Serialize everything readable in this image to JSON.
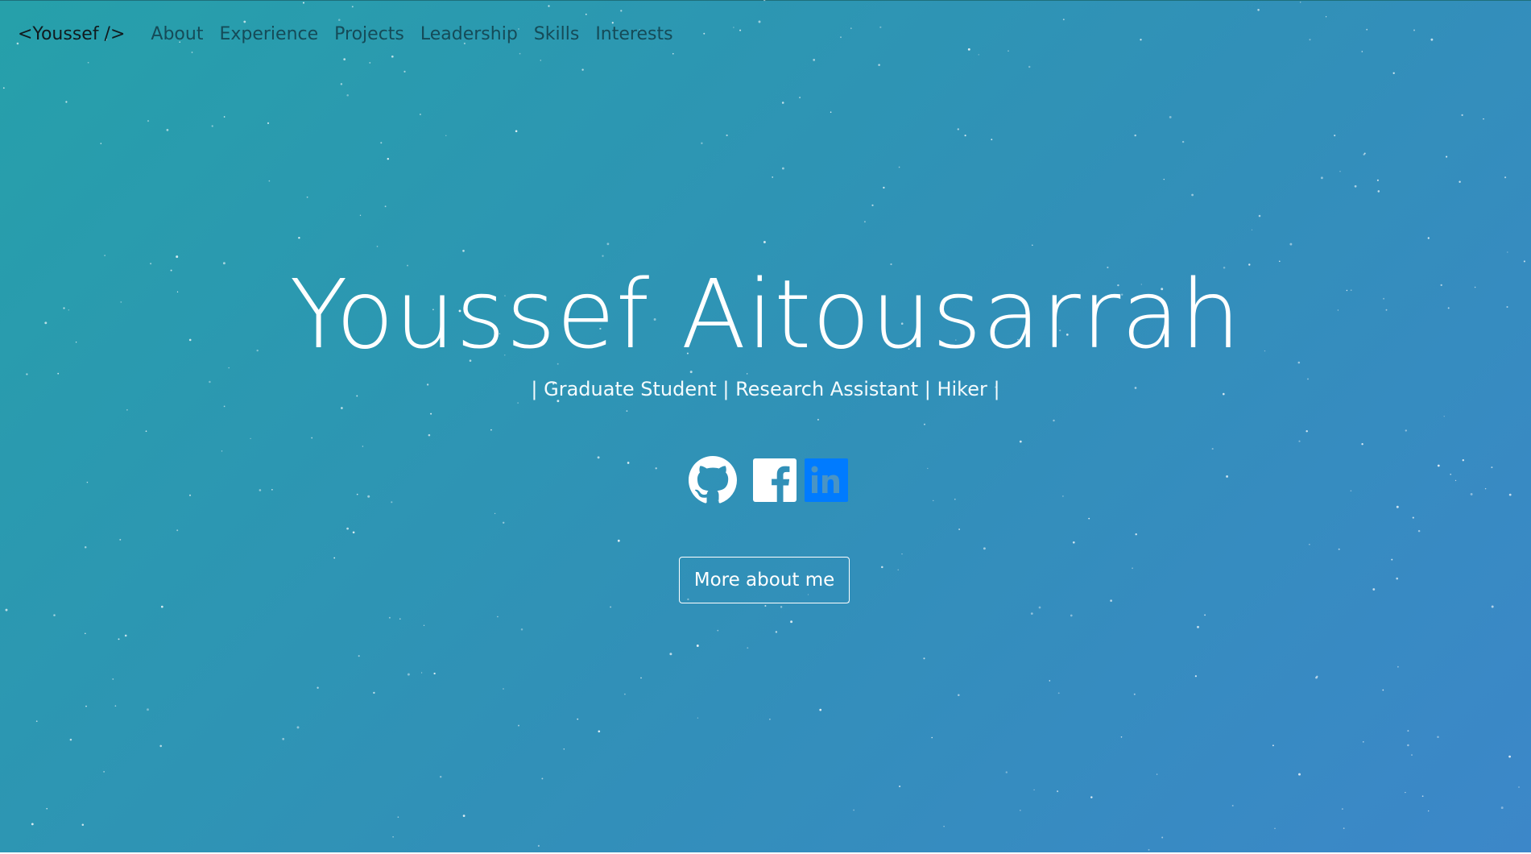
{
  "nav": {
    "brand": "<Youssef />",
    "links": [
      "About",
      "Experience",
      "Projects",
      "Leadership",
      "Skills",
      "Interests"
    ]
  },
  "hero": {
    "name": "Youssef Aitousarrah",
    "tagline": "| Graduate Student | Research Assistant | Hiker |",
    "more_button": "More about me"
  },
  "socials": [
    {
      "icon": "github-icon",
      "color": "#ffffff"
    },
    {
      "icon": "facebook-icon",
      "color": "#ffffff"
    },
    {
      "icon": "linkedin-icon",
      "color": "#007bff"
    }
  ],
  "colors": {
    "gradient_start": "#26a0aa",
    "gradient_end": "#3c87c9",
    "nav_link": "#154b58",
    "brand": "#111a1e",
    "text": "#ffffff",
    "linkedin": "#007bff"
  }
}
